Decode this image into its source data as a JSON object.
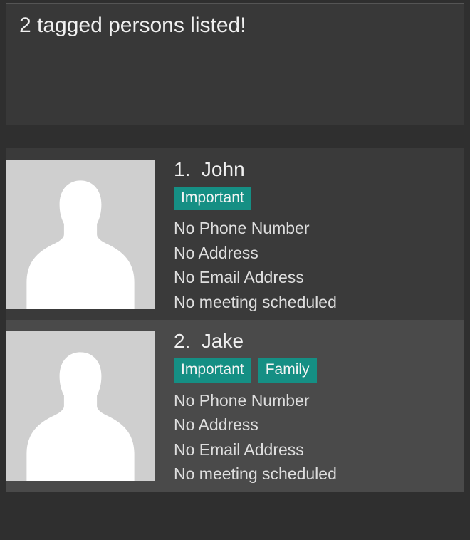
{
  "banner": {
    "title": "2 tagged persons listed!"
  },
  "persons": [
    {
      "index": "1.",
      "name": "John",
      "tags": [
        "Important"
      ],
      "phone": "No Phone Number",
      "address": "No Address",
      "email": "No Email Address",
      "meeting": "No meeting scheduled"
    },
    {
      "index": "2.",
      "name": "Jake",
      "tags": [
        "Important",
        "Family"
      ],
      "phone": "No Phone Number",
      "address": "No Address",
      "email": "No Email Address",
      "meeting": "No meeting scheduled"
    }
  ],
  "colors": {
    "tag_bg": "#158f84",
    "avatar_bg": "#cfcfcf"
  }
}
